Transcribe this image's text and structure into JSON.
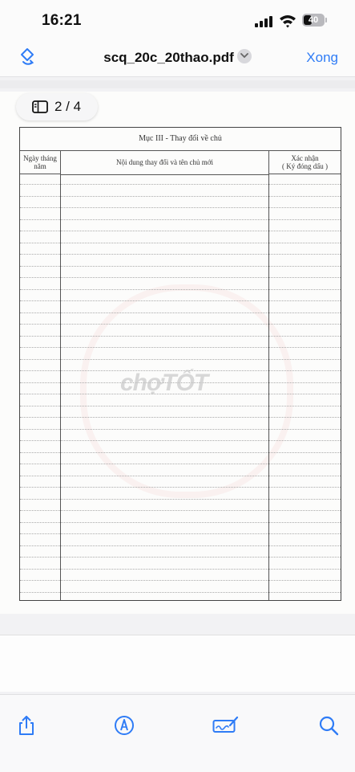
{
  "status_bar": {
    "time": "16:21",
    "battery_text": "40",
    "battery_level": 0.4
  },
  "nav": {
    "title": "scq_20c_20thao.pdf",
    "done_label": "Xong"
  },
  "viewer": {
    "page_indicator": "2 / 4"
  },
  "form": {
    "section_title": "Mục III - Thay đổi về chủ",
    "col_date_line1": "Ngày tháng",
    "col_date_line2": "năm",
    "col_content": "Nội dung thay đổi và tên chủ mới",
    "col_confirm_line1": "Xác nhận",
    "col_confirm_line2": "( Ký đóng dấu )"
  },
  "watermark": {
    "text": "chợTỐT"
  },
  "toolbar": {
    "icons": [
      "share-icon",
      "markup-icon",
      "signature-icon",
      "search-icon"
    ]
  },
  "colors": {
    "accent": "#2f7cf6"
  }
}
